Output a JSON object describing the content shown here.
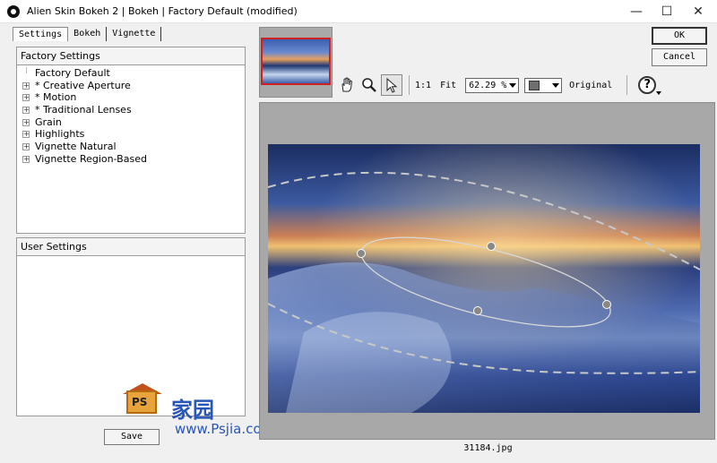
{
  "window": {
    "title": "Alien Skin Bokeh 2 | Bokeh | Factory Default (modified)",
    "minimize": "—",
    "maximize": "☐",
    "close": "✕"
  },
  "tabs": [
    {
      "label": "Settings"
    },
    {
      "label": "Bokeh"
    },
    {
      "label": "Vignette"
    }
  ],
  "factory_settings": {
    "header": "Factory Settings",
    "items": [
      {
        "label": "Factory Default",
        "expandable": false
      },
      {
        "label": "* Creative Aperture",
        "expandable": true
      },
      {
        "label": "* Motion",
        "expandable": true
      },
      {
        "label": "* Traditional Lenses",
        "expandable": true
      },
      {
        "label": "Grain",
        "expandable": true
      },
      {
        "label": "Highlights",
        "expandable": true
      },
      {
        "label": "Vignette Natural",
        "expandable": true
      },
      {
        "label": "Vignette Region-Based",
        "expandable": true
      }
    ]
  },
  "user_settings": {
    "header": "User Settings"
  },
  "buttons": {
    "save": "Save",
    "ok": "OK",
    "cancel": "Cancel"
  },
  "toolbar": {
    "tools": [
      "hand-icon",
      "magnifier-icon",
      "pointer-icon"
    ],
    "one_to_one": "1:1",
    "fit": "Fit",
    "zoom_value": "62.29 %",
    "background_color": "#6e6e6e",
    "original": "Original",
    "help": "?"
  },
  "preview": {
    "filename": "31184.jpg"
  },
  "watermark": {
    "ps": "PS",
    "chinese": "家园",
    "url": "www.Psjia.com"
  },
  "colors": {
    "accent_red": "#d02020",
    "watermark_blue": "#2856b8"
  }
}
